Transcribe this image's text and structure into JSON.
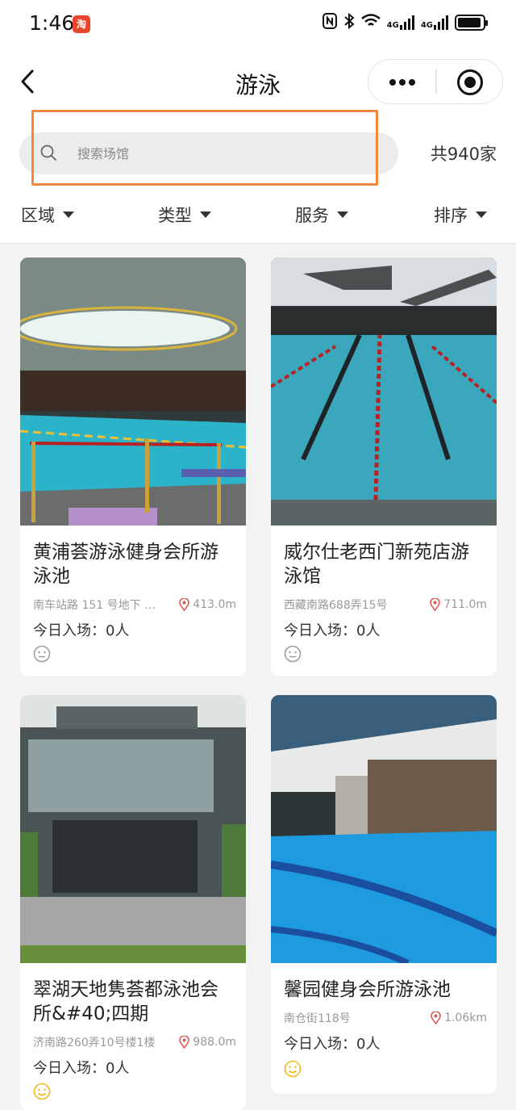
{
  "status": {
    "time": "1:46",
    "app_badge": "淘",
    "network_1": "4G",
    "network_2": "4G"
  },
  "nav": {
    "title": "游泳"
  },
  "search": {
    "placeholder": "搜索场馆",
    "count": "共940家"
  },
  "filters": [
    {
      "label": "区域"
    },
    {
      "label": "类型"
    },
    {
      "label": "服务"
    },
    {
      "label": "排序"
    }
  ],
  "venues": [
    {
      "name": "黄浦荟游泳健身会所游泳池",
      "address": "南车站路 151 号地下 …",
      "distance": "413.0m",
      "entries": "今日入场：0人",
      "mood": "neutral",
      "mood_color": "#9a9a9a"
    },
    {
      "name": "威尔仕老西门新苑店游泳馆",
      "address": "西藏南路688弄15号",
      "distance": "711.0m",
      "entries": "今日入场：0人",
      "mood": "neutral",
      "mood_color": "#9a9a9a"
    },
    {
      "name": "翠湖天地隽荟都泳池会所&#40;四期",
      "address": "济南路260弄10号楼1楼",
      "distance": "988.0m",
      "entries": "今日入场：0人",
      "mood": "happy",
      "mood_color": "#f2b81c"
    },
    {
      "name": "馨园健身会所游泳池",
      "address": "南仓街118号",
      "distance": "1.06km",
      "entries": "今日入场：0人",
      "mood": "happy",
      "mood_color": "#f2b81c"
    }
  ],
  "colors": {
    "highlight": "#ef8a3c",
    "pin": "#e2584f",
    "pool": "#2bb4c9"
  }
}
